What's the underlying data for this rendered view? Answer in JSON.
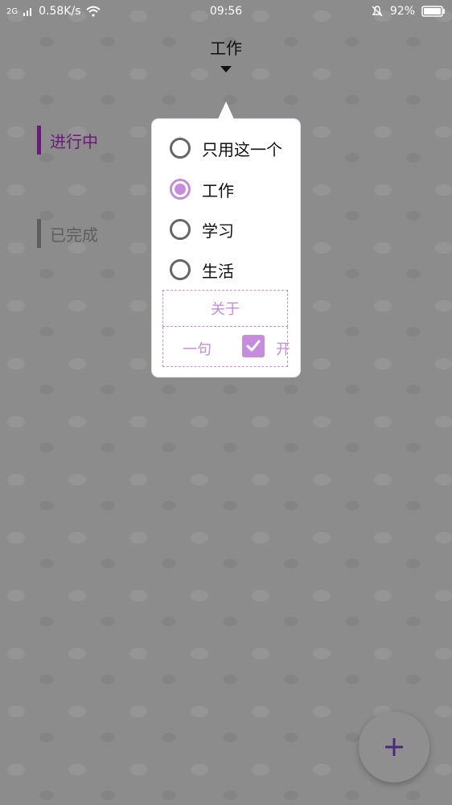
{
  "status_bar": {
    "signal": "2G",
    "speed": "0.58K/s",
    "time": "09:56",
    "battery": "92%"
  },
  "header": {
    "title": "工作"
  },
  "side_tabs": [
    {
      "label": "进行中",
      "active": true
    },
    {
      "label": "已完成",
      "active": false
    }
  ],
  "popup": {
    "options": [
      {
        "label": "只用这一个",
        "selected": false
      },
      {
        "label": "工作",
        "selected": true
      },
      {
        "label": "学习",
        "selected": false
      },
      {
        "label": "生活",
        "selected": false
      }
    ],
    "about_label": "关于",
    "quote_label": "一句",
    "quote_checked": true,
    "toggle_label": "开"
  },
  "fab": {
    "icon": "plus-icon"
  },
  "colors": {
    "accent": "#c58ddb",
    "active_tab": "#6a1b7a",
    "inactive_tab": "#5e5e5e",
    "fab_plus": "#4a2a7a",
    "background": "#8c8c8c"
  }
}
